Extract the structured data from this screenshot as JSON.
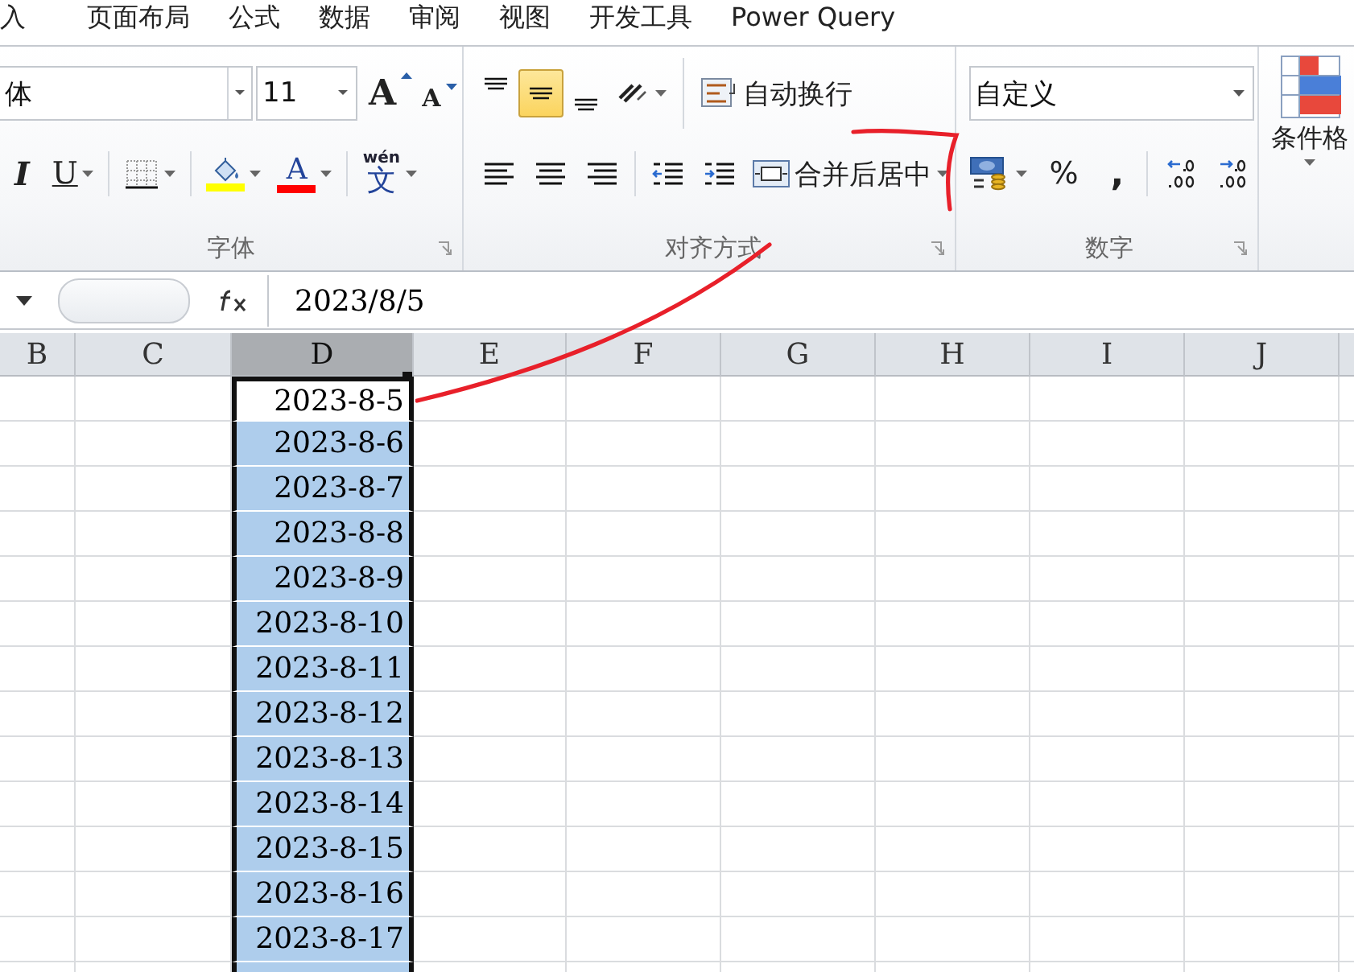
{
  "menu_tabs": [
    {
      "label": "入",
      "selected": false
    },
    {
      "label": "页面布局",
      "selected": false
    },
    {
      "label": "公式",
      "selected": false
    },
    {
      "label": "数据",
      "selected": false
    },
    {
      "label": "审阅",
      "selected": false
    },
    {
      "label": "视图",
      "selected": false
    },
    {
      "label": "开发工具",
      "selected": false
    },
    {
      "label": "Power Query",
      "selected": false
    }
  ],
  "font_group": {
    "font_name": "体",
    "font_size": "11",
    "size_buttons": [
      {
        "kind": "grow",
        "glyph": "A"
      },
      {
        "kind": "shrink",
        "glyph": "A"
      }
    ],
    "tools": [
      {
        "kind": "italic",
        "glyph": "I"
      },
      {
        "kind": "underline",
        "glyph": "U",
        "dropdown": true
      },
      {
        "kind": "borders",
        "dropdown": true
      },
      {
        "kind": "fill",
        "dropdown": true,
        "color": "#ffff00"
      },
      {
        "kind": "font_color",
        "glyph": "A",
        "dropdown": true,
        "color": "#ff0000"
      },
      {
        "kind": "phonetic",
        "glyph": "文",
        "ruby": "wén",
        "dropdown": true
      }
    ],
    "label": "字体"
  },
  "align_group": {
    "vertical": [
      {
        "kind": "top",
        "selected": false
      },
      {
        "kind": "middle",
        "selected": true
      },
      {
        "kind": "bottom",
        "selected": false
      }
    ],
    "horizontal": [
      {
        "kind": "left",
        "selected": false
      },
      {
        "kind": "center",
        "selected": false
      },
      {
        "kind": "right",
        "selected": false
      }
    ],
    "wrap_label": "自动换行",
    "merge_label": "合并后居中",
    "label": "对齐方式"
  },
  "number_group": {
    "format": "自定义",
    "tools": [
      {
        "kind": "accounting",
        "dropdown": true
      },
      {
        "kind": "percent",
        "glyph": "%"
      },
      {
        "kind": "comma",
        "glyph": ","
      },
      {
        "kind": "inc_decimal"
      },
      {
        "kind": "dec_decimal"
      }
    ],
    "label": "数字"
  },
  "styles_group": {
    "label": "条件格"
  },
  "formula_bar": {
    "value": "2023/8/5"
  },
  "columns": [
    {
      "label": "B",
      "selected": false
    },
    {
      "label": "C",
      "selected": false
    },
    {
      "label": "D",
      "selected": true
    },
    {
      "label": "E",
      "selected": false
    },
    {
      "label": "F",
      "selected": false
    },
    {
      "label": "G",
      "selected": false
    },
    {
      "label": "H",
      "selected": false
    },
    {
      "label": "I",
      "selected": false
    },
    {
      "label": "J",
      "selected": false
    }
  ],
  "rows": [
    {
      "value": "2023-8-5",
      "selected": false
    },
    {
      "value": "2023-8-6",
      "selected": true
    },
    {
      "value": "2023-8-7",
      "selected": true
    },
    {
      "value": "2023-8-8",
      "selected": true
    },
    {
      "value": "2023-8-9",
      "selected": true
    },
    {
      "value": "2023-8-10",
      "selected": true
    },
    {
      "value": "2023-8-11",
      "selected": true
    },
    {
      "value": "2023-8-12",
      "selected": true
    },
    {
      "value": "2023-8-13",
      "selected": true
    },
    {
      "value": "2023-8-14",
      "selected": true
    },
    {
      "value": "2023-8-15",
      "selected": true
    },
    {
      "value": "2023-8-16",
      "selected": true
    },
    {
      "value": "2023-8-17",
      "selected": true
    }
  ]
}
